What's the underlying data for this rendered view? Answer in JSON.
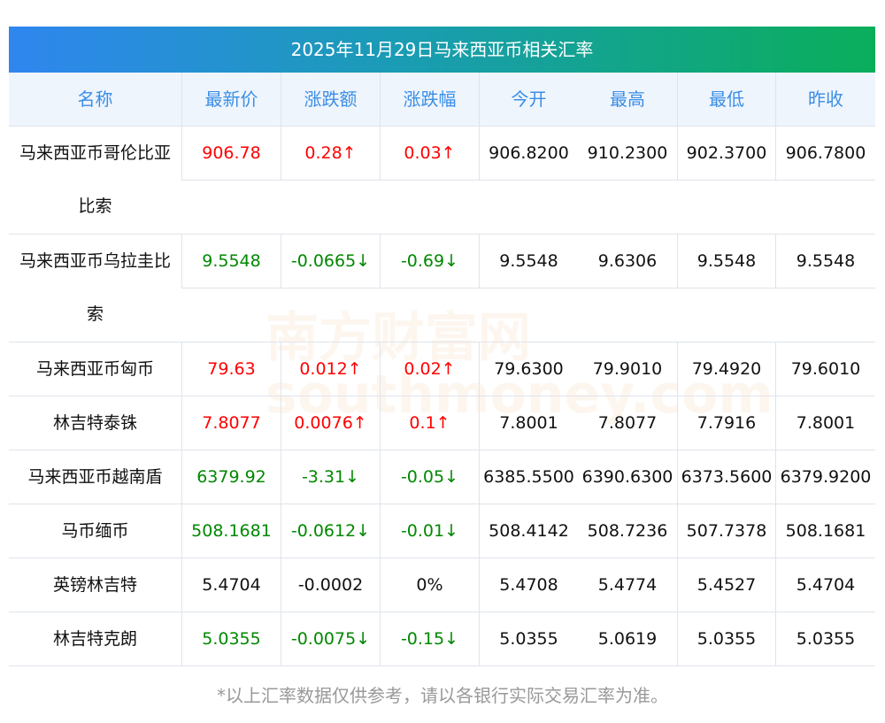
{
  "title": "2025年11月29日马来西亚币相关汇率",
  "headers": [
    "名称",
    "最新价",
    "涨跌额",
    "涨跌幅",
    "今开",
    "最高",
    "最低",
    "昨收"
  ],
  "rows": [
    {
      "name": "马来西亚币哥伦比亚比索",
      "price": "906.78",
      "change": "0.28↑",
      "pct": "0.03↑",
      "open": "906.8200",
      "high": "910.2300",
      "low": "902.3700",
      "prev": "906.7800",
      "trend": "up"
    },
    {
      "name": "马来西亚币乌拉圭比索",
      "price": "9.5548",
      "change": "-0.0665↓",
      "pct": "-0.69↓",
      "open": "9.5548",
      "high": "9.6306",
      "low": "9.5548",
      "prev": "9.5548",
      "trend": "down"
    },
    {
      "name": "马来西亚币匈币",
      "price": "79.63",
      "change": "0.012↑",
      "pct": "0.02↑",
      "open": "79.6300",
      "high": "79.9010",
      "low": "79.4920",
      "prev": "79.6010",
      "trend": "up"
    },
    {
      "name": "林吉特泰铢",
      "price": "7.8077",
      "change": "0.0076↑",
      "pct": "0.1↑",
      "open": "7.8001",
      "high": "7.8077",
      "low": "7.7916",
      "prev": "7.8001",
      "trend": "up"
    },
    {
      "name": "马来西亚币越南盾",
      "price": "6379.92",
      "change": "-3.31↓",
      "pct": "-0.05↓",
      "open": "6385.5500",
      "high": "6390.6300",
      "low": "6373.5600",
      "prev": "6379.9200",
      "trend": "down"
    },
    {
      "name": "马币缅币",
      "price": "508.1681",
      "change": "-0.0612↓",
      "pct": "-0.01↓",
      "open": "508.4142",
      "high": "508.7236",
      "low": "507.7378",
      "prev": "508.1681",
      "trend": "down"
    },
    {
      "name": "英镑林吉特",
      "price": "5.4704",
      "change": "-0.0002",
      "pct": "0%",
      "open": "5.4708",
      "high": "5.4774",
      "low": "5.4527",
      "prev": "5.4704",
      "trend": "flat"
    },
    {
      "name": "林吉特克朗",
      "price": "5.0355",
      "change": "-0.0075↓",
      "pct": "-0.15↓",
      "open": "5.0355",
      "high": "5.0619",
      "low": "5.0355",
      "prev": "5.0355",
      "trend": "down"
    }
  ],
  "footer": "*以上汇率数据仅供参考，请以各银行实际交易汇率为准。",
  "watermark": "南方财富网 southmoney.com",
  "colors": {
    "up": "#ff0000",
    "down": "#008800",
    "header_text": "#3a8ee6"
  }
}
